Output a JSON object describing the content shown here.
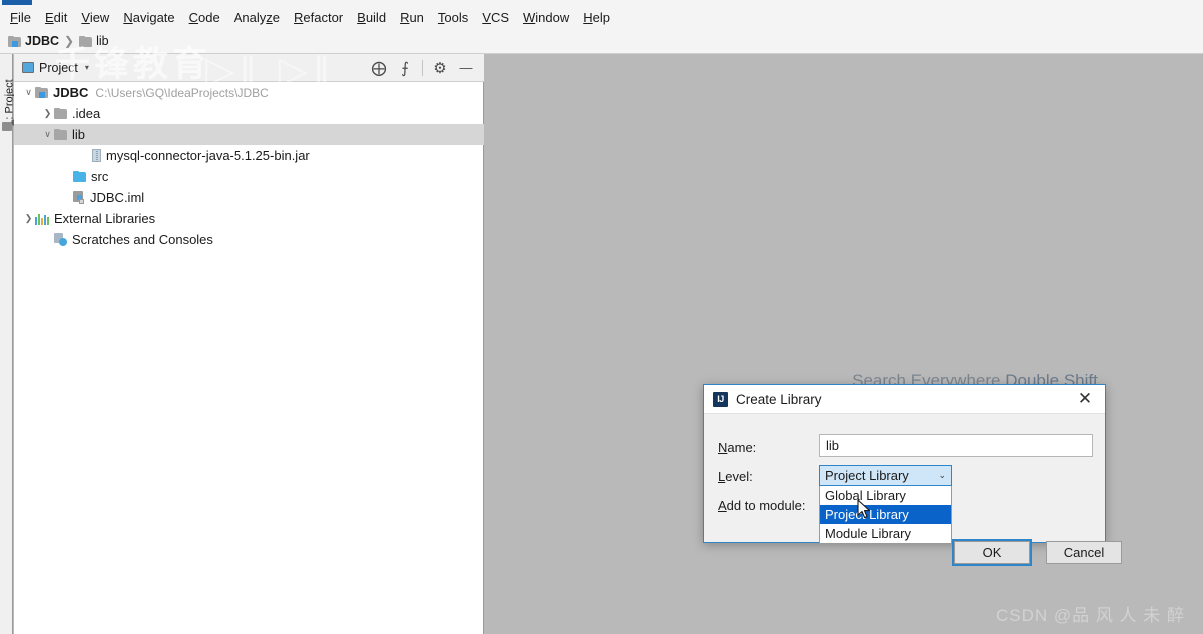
{
  "app": {
    "ide": "IntelliJ IDEA",
    "window_icon": "intellij-idea-icon"
  },
  "menubar": {
    "items": [
      {
        "label": "File",
        "mnemonic": "F"
      },
      {
        "label": "Edit",
        "mnemonic": "E"
      },
      {
        "label": "View",
        "mnemonic": "V"
      },
      {
        "label": "Navigate",
        "mnemonic": "N"
      },
      {
        "label": "Code",
        "mnemonic": "C"
      },
      {
        "label": "Analyze",
        "mnemonic": "z"
      },
      {
        "label": "Refactor",
        "mnemonic": "R"
      },
      {
        "label": "Build",
        "mnemonic": "B"
      },
      {
        "label": "Run",
        "mnemonic": "R"
      },
      {
        "label": "Tools",
        "mnemonic": "T"
      },
      {
        "label": "VCS",
        "mnemonic": "V"
      },
      {
        "label": "Window",
        "mnemonic": "W"
      },
      {
        "label": "Help",
        "mnemonic": "H"
      }
    ]
  },
  "breadcrumb": {
    "separator": "❯",
    "items": [
      {
        "label": "JDBC",
        "icon": "module-icon"
      },
      {
        "label": "lib",
        "icon": "folder-icon"
      }
    ]
  },
  "left_strip": {
    "project_tab": "1: Project",
    "project_tab_mnemonic": "1",
    "structure_icon": "structure-icon"
  },
  "project_panel": {
    "tab_label": "Project",
    "tab_icon": "project-window-icon",
    "toolbar_buttons": [
      {
        "name": "locate-in-tree-icon",
        "glyph": "⊕"
      },
      {
        "name": "collapse-all-icon",
        "glyph": "⨍"
      },
      {
        "name": "gear-icon",
        "glyph": "⚙"
      },
      {
        "name": "minimize-icon",
        "glyph": "—"
      }
    ],
    "tree": [
      {
        "label": "JDBC",
        "path": "C:\\Users\\GQ\\IdeaProjects\\JDBC",
        "icon": "module-icon",
        "indent": 0,
        "twisty": "expanded",
        "bold": true,
        "selected": false
      },
      {
        "label": ".idea",
        "path": "",
        "icon": "folder-icon",
        "indent": 1,
        "twisty": "collapsed",
        "bold": false,
        "selected": false
      },
      {
        "label": "lib",
        "path": "",
        "icon": "folder-icon",
        "indent": 1,
        "twisty": "expanded",
        "bold": false,
        "selected": true
      },
      {
        "label": "mysql-connector-java-5.1.25-bin.jar",
        "path": "",
        "icon": "jar-icon",
        "indent": 3,
        "twisty": "none",
        "bold": false,
        "selected": false
      },
      {
        "label": "src",
        "path": "",
        "icon": "source-folder-icon",
        "indent": 2,
        "twisty": "none",
        "bold": false,
        "selected": false
      },
      {
        "label": "JDBC.iml",
        "path": "",
        "icon": "iml-file-icon",
        "indent": 2,
        "twisty": "none",
        "bold": false,
        "selected": false
      },
      {
        "label": "External Libraries",
        "path": "",
        "icon": "external-libraries-icon",
        "indent": 0,
        "twisty": "collapsed",
        "bold": false,
        "selected": false
      },
      {
        "label": "Scratches and Consoles",
        "path": "",
        "icon": "scratches-icon",
        "indent": 1,
        "twisty": "none",
        "bold": false,
        "selected": false
      }
    ]
  },
  "editor": {
    "search_hint_text": "Search Everywhere",
    "search_hint_shortcut": "Double Shift",
    "background_color": "#b9b9b9"
  },
  "watermarks": {
    "top_left": "千锋教育",
    "top_play": "▷‖ ▷‖",
    "bottom_right": "CSDN @品 风 人 未 醉"
  },
  "dialog": {
    "title": "Create Library",
    "icon": "intellij-idea-icon",
    "close_glyph": "✕",
    "fields": {
      "name_label": "Name:",
      "name_mnemonic": "N",
      "name_value": "lib",
      "level_label": "Level:",
      "level_mnemonic": "L",
      "level_value": "Project Library",
      "level_arrow": "⌄",
      "addto_label": "Add to module:",
      "addto_mnemonic": "A"
    },
    "level_options": [
      {
        "label": "Global Library",
        "selected": false
      },
      {
        "label": "Project Library",
        "selected": true
      },
      {
        "label": "Module Library",
        "selected": false
      }
    ],
    "buttons": {
      "ok": "OK",
      "cancel": "Cancel"
    },
    "accent_color": "#2e86c8",
    "highlight_color": "#0a63c8"
  }
}
